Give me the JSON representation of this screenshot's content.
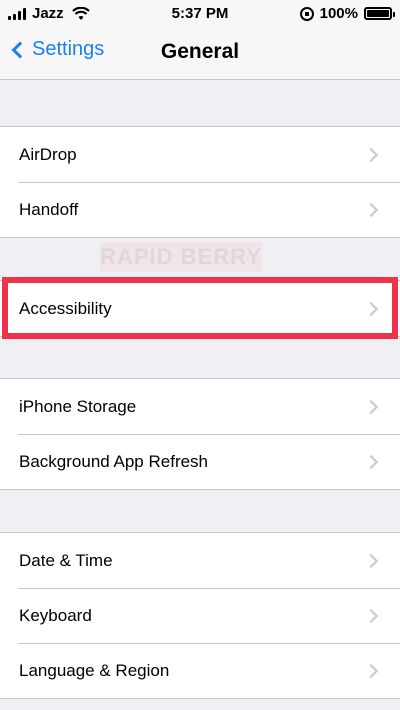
{
  "status_bar": {
    "carrier": "Jazz",
    "time": "5:37 PM",
    "battery": "100%",
    "icons": [
      "signal-icon",
      "wifi-icon",
      "rotation-lock-icon",
      "battery-icon"
    ]
  },
  "nav": {
    "back_label": "Settings",
    "title": "General"
  },
  "groups": [
    {
      "rows": [
        "AirDrop",
        "Handoff"
      ]
    },
    {
      "rows": [
        "Accessibility"
      ],
      "highlighted": true
    },
    {
      "rows": [
        "iPhone Storage",
        "Background App Refresh"
      ]
    },
    {
      "rows": [
        "Date & Time",
        "Keyboard",
        "Language & Region"
      ]
    }
  ],
  "watermark": "RAPID BERRY",
  "colors": {
    "accent": "#1a7ff5",
    "highlight": "#f0334b",
    "background": "#efeff4"
  }
}
